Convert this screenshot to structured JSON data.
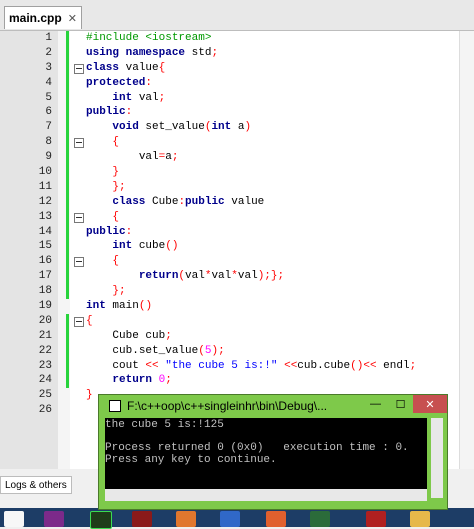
{
  "tab": {
    "label": "main.cpp",
    "close": "✕"
  },
  "code": {
    "lines": [
      {
        "n": "1",
        "text": "#include <iostream>"
      },
      {
        "n": "2",
        "text": "using namespace std;"
      },
      {
        "n": "3",
        "text": "class value{"
      },
      {
        "n": "4",
        "text": "protected:"
      },
      {
        "n": "5",
        "text": "    int val;"
      },
      {
        "n": "6",
        "text": "public:"
      },
      {
        "n": "7",
        "text": "    void set_value(int a)"
      },
      {
        "n": "8",
        "text": "    {"
      },
      {
        "n": "9",
        "text": "        val=a;"
      },
      {
        "n": "10",
        "text": "    }"
      },
      {
        "n": "11",
        "text": "    };"
      },
      {
        "n": "12",
        "text": "    class Cube:public value"
      },
      {
        "n": "13",
        "text": "    {"
      },
      {
        "n": "14",
        "text": "public:"
      },
      {
        "n": "15",
        "text": "    int cube()"
      },
      {
        "n": "16",
        "text": "    {"
      },
      {
        "n": "17",
        "text": "        return(val*val*val);};"
      },
      {
        "n": "18",
        "text": "    };"
      },
      {
        "n": "19",
        "text": "int main()"
      },
      {
        "n": "20",
        "text": "{"
      },
      {
        "n": "21",
        "text": "    Cube cub;"
      },
      {
        "n": "22",
        "text": "    cub.set_value(5);"
      },
      {
        "n": "23",
        "text": "    cout << \"the cube 5 is:!\" <<cub.cube()<< endl;"
      },
      {
        "n": "24",
        "text": "    return 0;"
      },
      {
        "n": "25",
        "text": "}"
      },
      {
        "n": "26",
        "text": ""
      }
    ]
  },
  "bottom": {
    "logs_tab": "Logs & others"
  },
  "terminal": {
    "title": "F:\\c++oop\\c++singleinhr\\bin\\Debug\\...",
    "minimize": "—",
    "maximize": "☐",
    "close": "✕",
    "output": "the cube 5 is:!125\n\nProcess returned 0 (0x0)   execution time : 0.\nPress any key to continue."
  },
  "colors": {
    "keyword": "#00008b",
    "preprocessor": "#009900",
    "string": "#0000ff",
    "number": "#ff00ff",
    "operator": "#ff0000",
    "changebar": "#28d43c",
    "terminal_frame": "#7ec94a"
  }
}
